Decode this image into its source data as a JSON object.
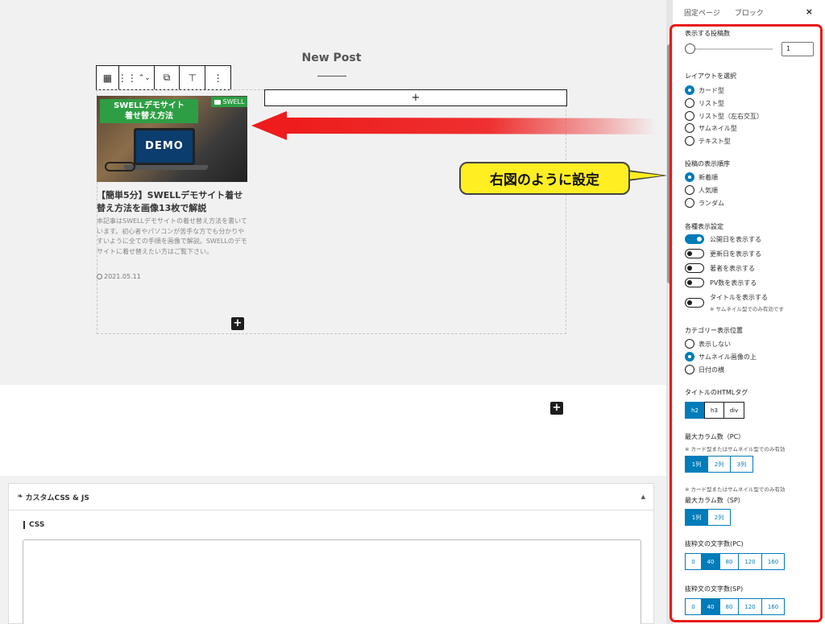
{
  "canvas": {
    "section_title": "New Post",
    "toolbar": [
      "▦",
      "⋮⋮",
      "⌃⌄",
      "⧉",
      "⊤",
      "⋮"
    ],
    "appender_label": "+",
    "add_block_label": "+"
  },
  "card": {
    "thumb_banner": "SWELLデモサイト\n着せ替え方法",
    "thumb_screen": "DEMO",
    "category": "SWELL",
    "title": "【簡単5分】SWELLデモサイト着せ替え方法を画像13枚で解説",
    "excerpt": "本記事はSWELLデモサイトの着せ替え方法を書いています。初心者やパソコンが苦手な方でも分かりやすいように全ての手順を画像で解説。SWELLのデモサイトに着せ替えたい方はご覧下さい。",
    "date": "2021.05.11"
  },
  "callout": "右図のように設定",
  "meta_box": {
    "title": "カスタムCSS & JS",
    "caret": "▲",
    "css_label": "CSS"
  },
  "sidebar": {
    "tabs": [
      "固定ページ",
      "ブロック"
    ],
    "close": "×",
    "post_count": {
      "label": "表示する投稿数",
      "value": "1"
    },
    "layout": {
      "label": "レイアウトを選択",
      "options": [
        "カード型",
        "リスト型",
        "リスト型（左右交互）",
        "サムネイル型",
        "テキスト型"
      ],
      "selected": 0
    },
    "order": {
      "label": "投稿の表示順序",
      "options": [
        "新着順",
        "人気順",
        "ランダム"
      ],
      "selected": 0
    },
    "display": {
      "label": "各種表示設定",
      "toggles": [
        {
          "label": "公開日を表示する",
          "on": true
        },
        {
          "label": "更新日を表示する",
          "on": false
        },
        {
          "label": "著者を表示する",
          "on": false
        },
        {
          "label": "PV数を表示する",
          "on": false
        },
        {
          "label": "タイトルを表示する",
          "on": false
        }
      ],
      "title_note": "※ サムネイル型でのみ有効です"
    },
    "category_pos": {
      "label": "カテゴリー表示位置",
      "options": [
        "表示しない",
        "サムネイル画像の上",
        "日付の横"
      ],
      "selected": 1
    },
    "html_tag": {
      "label": "タイトルのHTMLタグ",
      "options": [
        "h2",
        "h3",
        "div"
      ],
      "selected": 0
    },
    "cols_pc": {
      "label": "最大カラム数（PC）",
      "note": "※ カード型またはサムネイル型でのみ有効",
      "options": [
        "1列",
        "2列",
        "3列"
      ],
      "selected": 0
    },
    "cols_sp": {
      "note": "※ カード型またはサムネイル型でのみ有効",
      "label": "最大カラム数（SP）",
      "options": [
        "1列",
        "2列"
      ],
      "selected": 0
    },
    "excerpt_pc": {
      "label": "抜粋文の文字数(PC)",
      "options": [
        "0",
        "40",
        "80",
        "120",
        "160"
      ],
      "selected": 1
    },
    "excerpt_sp": {
      "label": "抜粋文の文字数(SP)",
      "options": [
        "0",
        "40",
        "80",
        "120",
        "160"
      ],
      "selected": 1
    }
  },
  "colors": {
    "accent": "#007cba",
    "frame": "#e81818",
    "callout": "#ffee22",
    "category": "#2e9e44"
  }
}
